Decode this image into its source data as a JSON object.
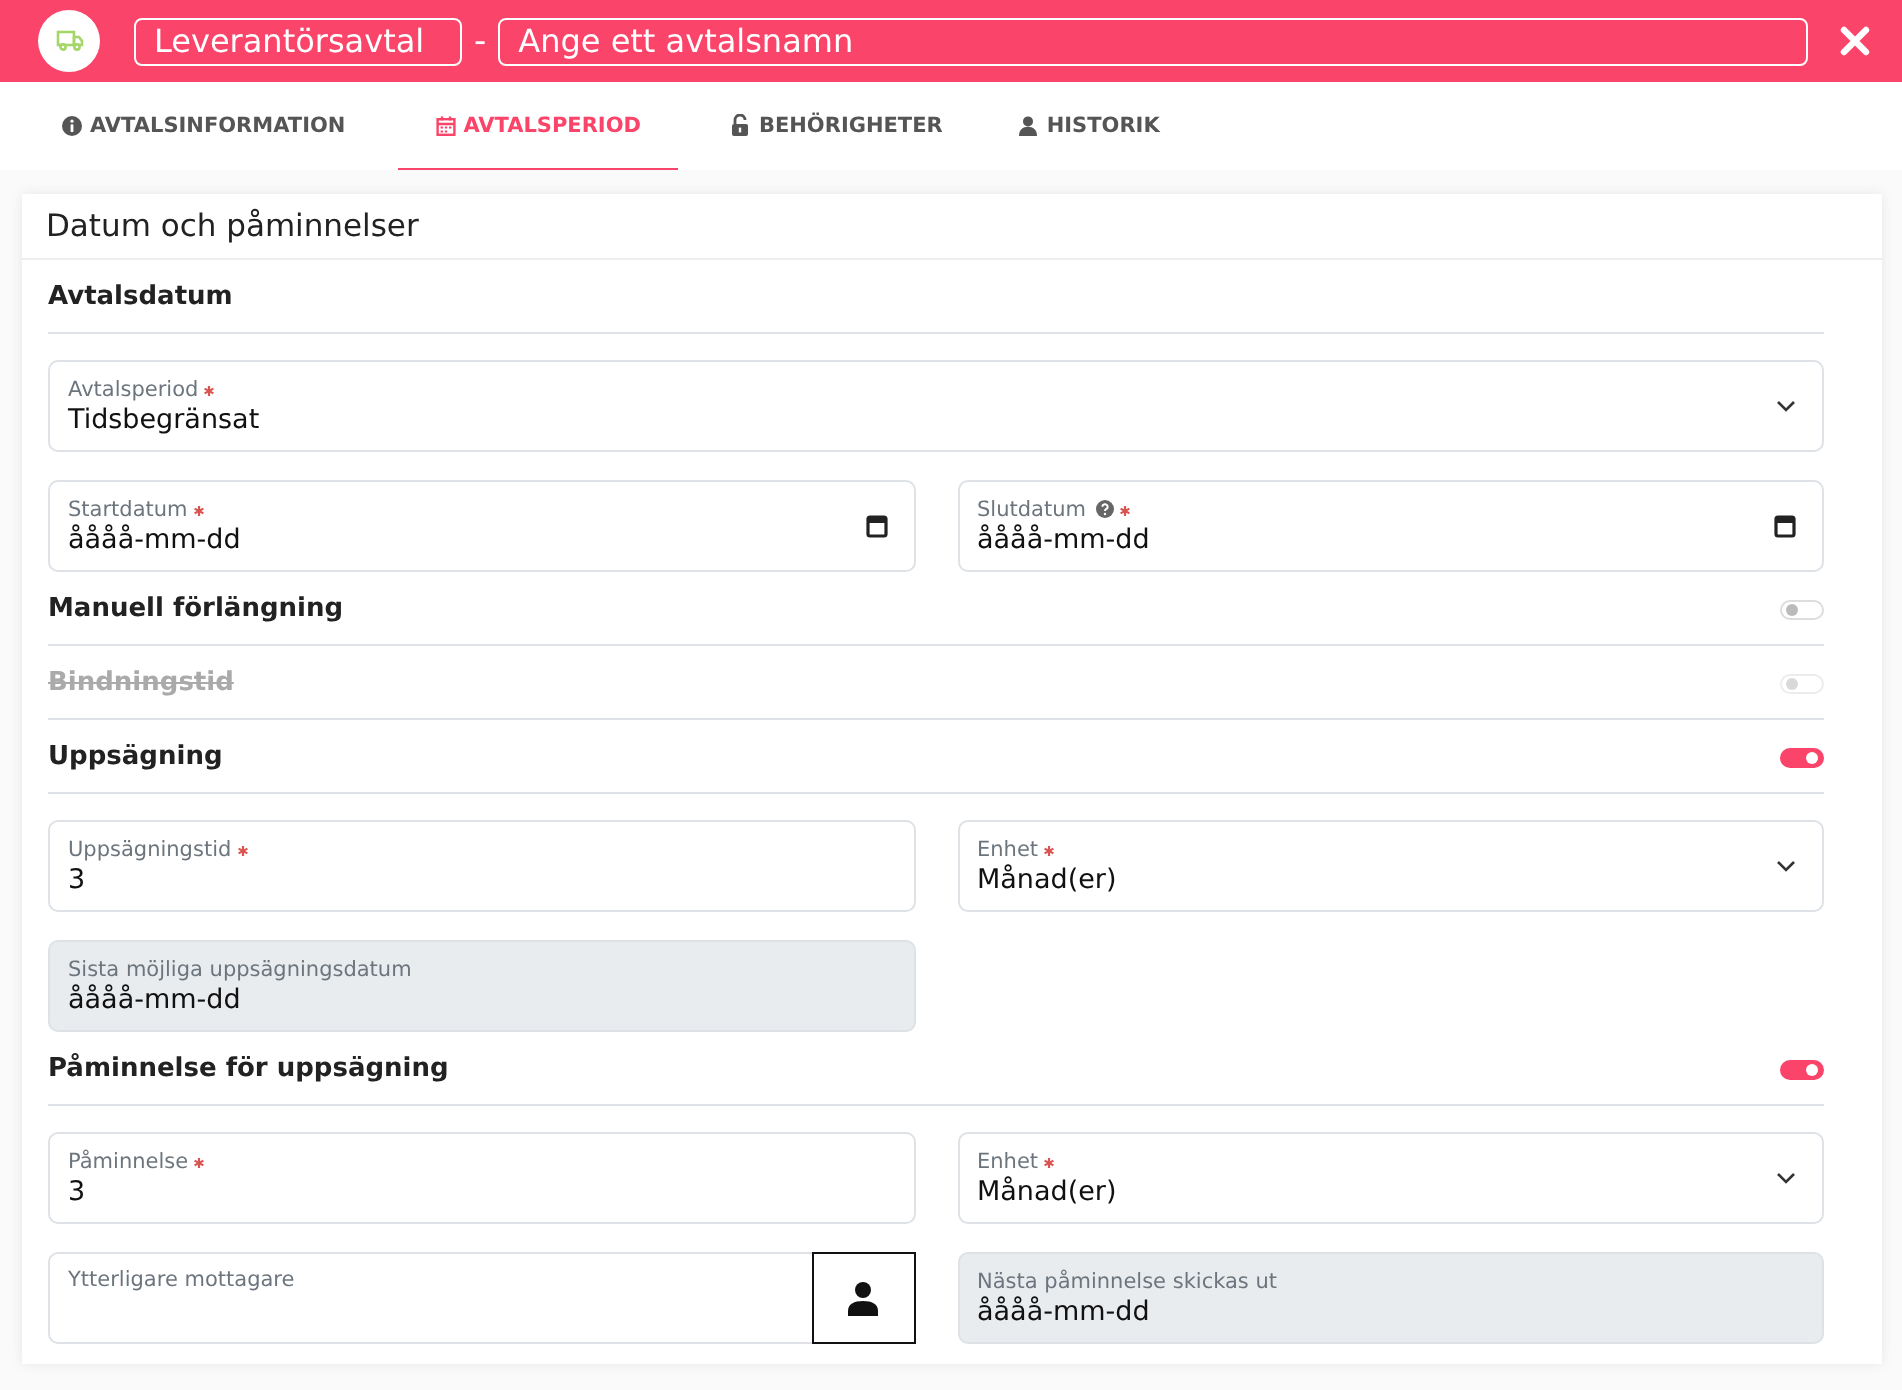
{
  "header": {
    "type_value": "Leverantörsavtal",
    "separator": "-",
    "name_placeholder": "Ange ett avtalsnamn"
  },
  "tabs": [
    {
      "label": "AVTALSINFORMATION",
      "selected": false
    },
    {
      "label": "AVTALSPERIOD",
      "selected": true
    },
    {
      "label": "BEHÖRIGHETER",
      "selected": false
    },
    {
      "label": "HISTORIK",
      "selected": false
    }
  ],
  "card": {
    "title": "Datum och påminnelser",
    "rows": [
      {
        "kind": "heading",
        "label": "Avtalsdatum",
        "disabled": false
      },
      {
        "kind": "wide",
        "fields": [
          {
            "kind": "select",
            "label": "Avtalsperiod",
            "required": true,
            "help": false,
            "value": "Tidsbegränsat"
          }
        ]
      },
      {
        "kind": "pair",
        "fields": [
          {
            "kind": "date",
            "label": "Startdatum",
            "required": true,
            "help": false,
            "value": "åååå-mm-dd"
          },
          {
            "kind": "date",
            "label": "Slutdatum",
            "required": true,
            "help": true,
            "value": "åååå-mm-dd"
          }
        ]
      },
      {
        "kind": "heading",
        "label": "Manuell förlängning",
        "disabled": false,
        "toggle": {
          "on": false,
          "disabled": false
        }
      },
      {
        "kind": "heading",
        "label": "Bindningstid",
        "disabled": true,
        "toggle": {
          "on": false,
          "disabled": true
        }
      },
      {
        "kind": "heading",
        "label": "Uppsägning",
        "disabled": false,
        "toggle": {
          "on": true,
          "disabled": false
        }
      },
      {
        "kind": "pair",
        "fields": [
          {
            "kind": "text",
            "label": "Uppsägningstid",
            "required": true,
            "help": false,
            "value": "3"
          },
          {
            "kind": "select",
            "label": "Enhet",
            "required": true,
            "help": false,
            "value": "Månad(er)"
          }
        ]
      },
      {
        "kind": "pair",
        "fields": [
          {
            "kind": "readonly",
            "label": "Sista möjliga uppsägningsdatum",
            "required": false,
            "help": false,
            "value": "åååå-mm-dd"
          }
        ]
      },
      {
        "kind": "heading",
        "label": "Påminnelse för uppsägning",
        "disabled": false,
        "toggle": {
          "on": true,
          "disabled": false
        }
      },
      {
        "kind": "pair",
        "fields": [
          {
            "kind": "text",
            "label": "Påminnelse",
            "required": true,
            "help": false,
            "value": "3"
          },
          {
            "kind": "select",
            "label": "Enhet",
            "required": true,
            "help": false,
            "value": "Månad(er)"
          }
        ]
      },
      {
        "kind": "pair",
        "fields": [
          {
            "kind": "recipient",
            "label": "Ytterligare mottagare",
            "required": false,
            "help": false
          },
          {
            "kind": "readonly",
            "label": "Nästa påminnelse skickas ut",
            "required": false,
            "help": false,
            "value": "åååå-mm-dd"
          }
        ]
      }
    ]
  }
}
